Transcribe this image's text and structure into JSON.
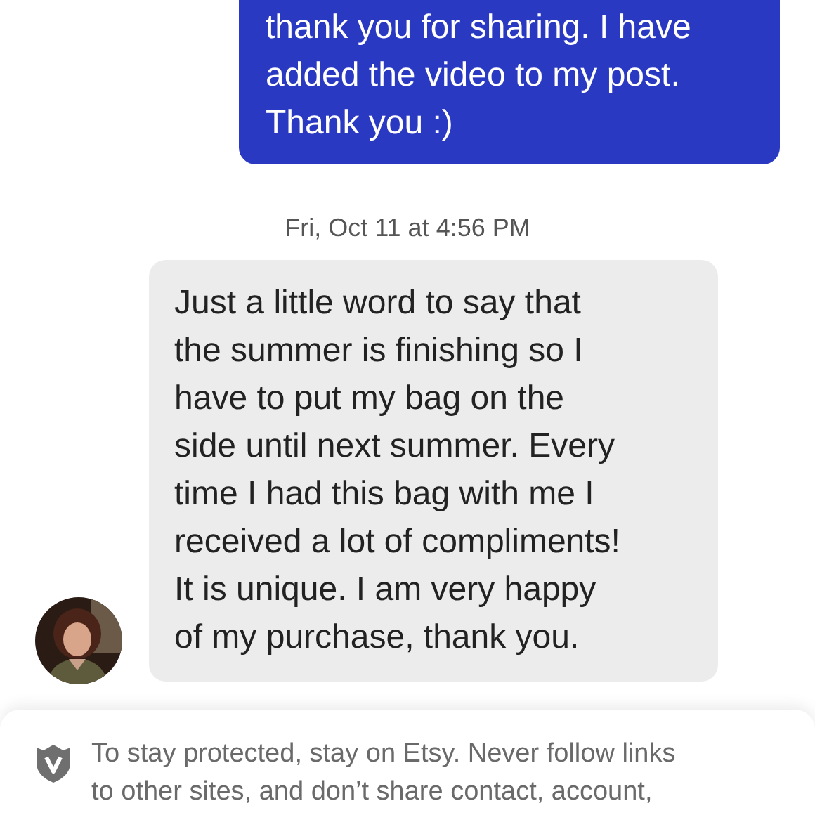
{
  "messages": [
    {
      "kind": "sent",
      "text": "thank you for sharing. I have\nadded the video to my post.\nThank you :)"
    },
    {
      "kind": "timestamp",
      "text": "Fri, Oct 11 at 4:56 PM"
    },
    {
      "kind": "received",
      "text": "Just a little word to say that\nthe summer is finishing so I\nhave to put my bag on the\nside until next summer. Every\ntime I had this bag with me I\nreceived a lot of compliments!\nIt is unique. I am very happy\nof my purchase, thank you."
    }
  ],
  "safety_notice": {
    "text": "To stay protected, stay on Etsy. Never follow links\nto other sites, and don’t share contact, account,"
  }
}
